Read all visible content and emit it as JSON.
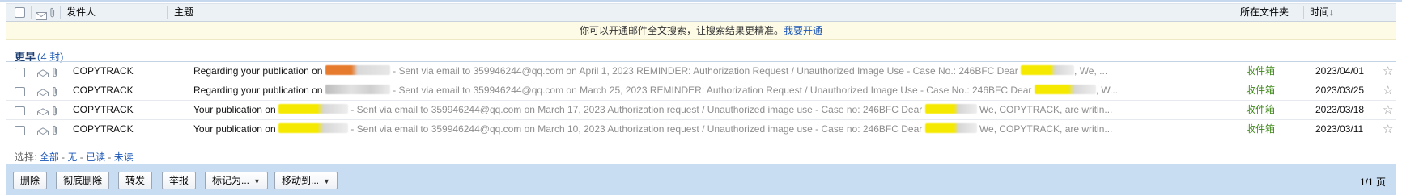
{
  "header": {
    "sender": "发件人",
    "subject": "主题",
    "folder": "所在文件夹",
    "time": "时间↓"
  },
  "notice": {
    "text": "你可以开通邮件全文搜索，让搜索结果更精准。",
    "link": "我要开通"
  },
  "group": {
    "label": "更早",
    "count": "(4 封)"
  },
  "rows": [
    {
      "sender": "COPYTRACK",
      "title": "Regarding your publication on ",
      "mid": " - Sent via email to 359946244@qq.com on April 1, 2023 REMINDER: Authorization Request / Unauthorized Image Use - Case No.: 246BFC Dear ",
      "tail": ", We, ...",
      "folder": "收件箱",
      "date": "2023/04/01"
    },
    {
      "sender": "COPYTRACK",
      "title": "Regarding your publication on ",
      "mid": " - Sent via email to 359946244@qq.com on March 25, 2023 REMINDER: Authorization Request / Unauthorized Image Use - Case No.: 246BFC Dear ",
      "tail": ", W...",
      "folder": "收件箱",
      "date": "2023/03/25"
    },
    {
      "sender": "COPYTRACK",
      "title": "Your publication on ",
      "mid": " - Sent via email to 359946244@qq.com on March 17, 2023 Authorization request / Unauthorized image use - Case no: 246BFC Dear ",
      "tail": " We, COPYTRACK, are writin...",
      "folder": "收件箱",
      "date": "2023/03/18"
    },
    {
      "sender": "COPYTRACK",
      "title": "Your publication on ",
      "mid": " - Sent via email to 359946244@qq.com on March 10, 2023 Authorization request / Unauthorized image use - Case no: 246BFC Dear ",
      "tail": " We, COPYTRACK, are writin...",
      "folder": "收件箱",
      "date": "2023/03/11"
    }
  ],
  "select": {
    "label": "选择:",
    "all": "全部",
    "none": "无",
    "read": "已读",
    "unread": "未读"
  },
  "toolbar": {
    "delete": "删除",
    "delete_forever": "彻底删除",
    "forward": "转发",
    "report": "举报",
    "mark_as": "标记为...",
    "move_to": "移动到...",
    "pager": "1/1 页"
  },
  "icons": {
    "star": "star-icon",
    "envelope": "envelope-icon",
    "attachment": "paperclip-icon"
  },
  "colors": {
    "header_bg": "#ecf1f6",
    "notice_bg": "#fdfbe6",
    "folder_green": "#3e8a18",
    "toolbar_bg": "#c8dcf2",
    "link_blue": "#1a56b8"
  }
}
